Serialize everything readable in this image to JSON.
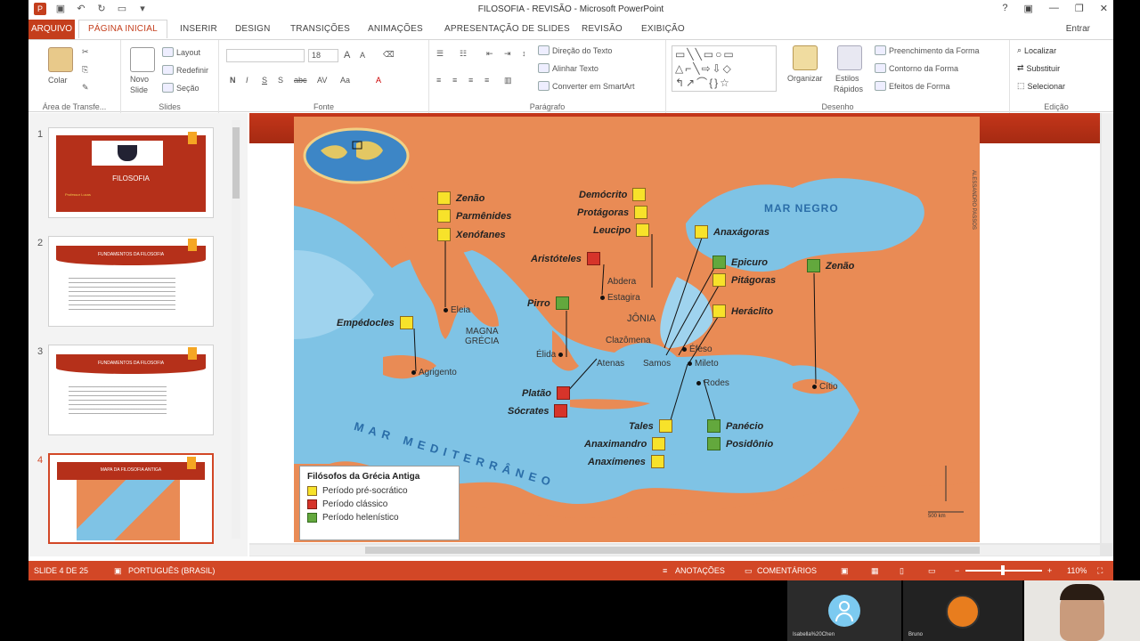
{
  "window": {
    "title": "FILOSOFIA - REVISÃO - Microsoft PowerPoint",
    "help": "?",
    "signin": "Entrar"
  },
  "tabs": [
    "ARQUIVO",
    "PÁGINA INICIAL",
    "INSERIR",
    "DESIGN",
    "TRANSIÇÕES",
    "ANIMAÇÕES",
    "APRESENTAÇÃO DE SLIDES",
    "REVISÃO",
    "EXIBIÇÃO"
  ],
  "ribbon": {
    "clipboard": {
      "paste": "Colar",
      "title": "Área de Transfe..."
    },
    "slides": {
      "new_slide_1": "Novo",
      "new_slide_2": "Slide",
      "layout": "Layout",
      "reset": "Redefinir",
      "section": "Seção",
      "title": "Slides"
    },
    "font": {
      "size": "18",
      "title": "Fonte",
      "bold": "N",
      "italic": "I",
      "underline": "S",
      "shadow": "S",
      "strike": "abc",
      "case": "Aa"
    },
    "paragraph": {
      "direction": "Direção do Texto",
      "align": "Alinhar Texto",
      "smartart": "Converter em SmartArt",
      "title": "Parágrafo"
    },
    "drawing": {
      "arrange": "Organizar",
      "styles_1": "Estilos",
      "styles_2": "Rápidos",
      "fill": "Preenchimento da Forma",
      "outline": "Contorno da Forma",
      "effects": "Efeitos de Forma",
      "title": "Desenho"
    },
    "editing": {
      "find": "Localizar",
      "replace": "Substituir",
      "select": "Selecionar",
      "title": "Edição"
    }
  },
  "thumbnails": [
    {
      "num": "1",
      "title": "FILOSOFIA",
      "subtitle": "Professor Lucas"
    },
    {
      "num": "2",
      "title": "FUNDAMENTOS DA FILOSOFIA"
    },
    {
      "num": "3",
      "title": "FUNDAMENTOS DA FILOSOFIA"
    },
    {
      "num": "4",
      "title": "MAPA DA FILOSOFIA ANTIGA"
    }
  ],
  "map": {
    "seas": {
      "black": "MAR NEGRO",
      "med": "MAR MEDITERRÂNEO"
    },
    "regions": {
      "magna_1": "MAGNA",
      "magna_2": "GRÉCIA",
      "jonia": "JÔNIA"
    },
    "philosophers": {
      "zenao1": "Zenão",
      "parmenides": "Parmênides",
      "xenofanes": "Xenófanes",
      "democrito": "Demócrito",
      "protagoras": "Protágoras",
      "leucipo": "Leucipo",
      "anaxagoras": "Anaxágoras",
      "aristoteles": "Aristóteles",
      "epicuro": "Epicuro",
      "pitagoras": "Pitágoras",
      "zenao2": "Zenão",
      "pirro": "Pirro",
      "heraclito": "Heráclito",
      "empedocles": "Empédocles",
      "platao": "Platão",
      "socrates": "Sócrates",
      "tales": "Tales",
      "anaximandro": "Anaximandro",
      "anaximenes": "Anaxímenes",
      "panecio": "Panécio",
      "posidonio": "Posidônio"
    },
    "cities": {
      "eleia": "Eleia",
      "abdera": "Abdera",
      "estagira": "Estagira",
      "elida": "Élida",
      "clazomena": "Clazômena",
      "atenas": "Atenas",
      "samos": "Samos",
      "efeso": "Éfeso",
      "mileto": "Mileto",
      "rodes": "Rodes",
      "citio": "Cítio",
      "agrigento": "Agrigento"
    },
    "legend": {
      "title": "Filósofos da Grécia Antiga",
      "pre": "Período pré-socrático",
      "classic": "Período clássico",
      "hellenistic": "Período helenístico"
    },
    "credit": "ALESSANDRO PASSOS",
    "scale": "500 km",
    "colors": {
      "pre": "#f7e22a",
      "classic": "#d6342a",
      "hellenistic": "#63a83d"
    }
  },
  "status": {
    "slide": "SLIDE 4 DE 25",
    "language": "PORTUGUÊS (BRASIL)",
    "notes": "ANOTAÇÕES",
    "comments": "COMENTÁRIOS",
    "zoom": "110%"
  },
  "participants": {
    "p1": "Isabella%20Chen",
    "p2": "Bruno"
  }
}
